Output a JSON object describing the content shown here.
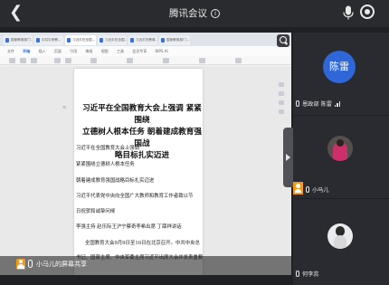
{
  "topbar": {
    "title": "腾讯会议",
    "info_glyph": "i"
  },
  "browser": {
    "tabs": [
      "国家教育部门...",
      "中共中央教...",
      "习近平在全国...",
      "习近平在全国...",
      "习近平在教育...",
      "国家教育部门..."
    ],
    "menu": [
      "文件",
      "开始",
      "插入",
      "页面",
      "引用",
      "审阅",
      "视图",
      "工具",
      "会员专享",
      "WPS AI"
    ],
    "margin_mark": "≡"
  },
  "document": {
    "headline_lines": [
      "习近平在全国教育大会上强调 紧紧围绕",
      "立德树人根本任务 朝着建成教育强国战",
      "略目标扎实迈进"
    ],
    "body_lines": [
      "习近平在全国教育大会上强调",
      "紧紧围绕立德树人根本任务",
      "朝着建成教育强国战略目标扎实迈进",
      "习近平代表党中央向全国广大教师和教育工作者致以节",
      "日祝贺和诚挚问候",
      "李强主持 赵乐际王沪宁蔡奇李希出席 丁薛祥讲话",
      "全国教育大会9月9日至10日在北京召开。中共中央总",
      "书记、国家主席、中央军委主席习近平出席大会并发表重要"
    ]
  },
  "share_label": "小马儿的屏幕共享",
  "participants": [
    {
      "avatar_text": "陈雷",
      "name": "恩政部 陈雷",
      "avatar_color": "#2f66d8"
    },
    {
      "name": "小马儿",
      "is_host": true
    },
    {
      "name": "何李蕊"
    }
  ]
}
